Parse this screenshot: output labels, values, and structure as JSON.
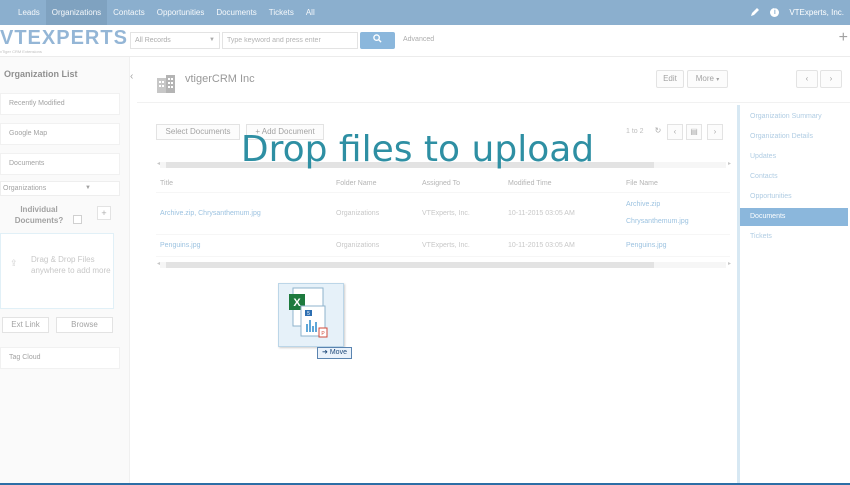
{
  "topnav": {
    "tabs": [
      {
        "label": "Leads"
      },
      {
        "label": "Organizations",
        "active": true
      },
      {
        "label": "Contacts"
      },
      {
        "label": "Opportunities"
      },
      {
        "label": "Documents"
      },
      {
        "label": "Tickets"
      },
      {
        "label": "All"
      }
    ],
    "user": "VTExperts, Inc.",
    "edit_icon": "pencil-icon",
    "help_icon": "info-icon"
  },
  "searchbar": {
    "logo": "VTEXPERTS",
    "logo_sub": "vTiger CRM Extensions",
    "records_select": "All Records",
    "search_placeholder": "Type keyword and press enter",
    "search_button_icon": "search-icon",
    "advanced": "Advanced",
    "add_icon": "plus-icon"
  },
  "sidebar": {
    "title": "Organization List",
    "items": [
      {
        "label": "Recently Modified"
      },
      {
        "label": "Google Map"
      },
      {
        "label": "Documents"
      }
    ],
    "dropdown": "Organizations",
    "individual_documents": "Individual Documents?",
    "add_button": "+",
    "dropzone_text": "Drag & Drop Files anywhere to add more",
    "ext_link": "Ext Link",
    "browse": "Browse",
    "tag_cloud": "Tag Cloud"
  },
  "header": {
    "org_name": "vtigerCRM Inc",
    "edit": "Edit",
    "more": "More"
  },
  "documents": {
    "select_documents": "Select Documents",
    "add_document": "+ Add Document",
    "pager": "1 to 2",
    "columns": [
      "Title",
      "Folder Name",
      "Assigned To",
      "Modified Time",
      "File Name"
    ],
    "rows": [
      {
        "title": "Archive.zip, Chrysanthemum.jpg",
        "folder": "Organizations",
        "assigned": "VTExperts, Inc.",
        "modified": "10-11-2015 03:05 AM",
        "files": [
          "Archive.zip",
          "Chrysanthemum.jpg"
        ]
      },
      {
        "title": "Penguins.jpg",
        "folder": "Organizations",
        "assigned": "VTExperts, Inc.",
        "modified": "10-11-2015 03:05 AM",
        "files": [
          "Penguins.jpg"
        ]
      }
    ]
  },
  "overlay": {
    "drop_text": "Drop files to upload",
    "move_label": "Move"
  },
  "rightpanel": {
    "items": [
      {
        "label": "Organization Summary"
      },
      {
        "label": "Organization Details"
      },
      {
        "label": "Updates"
      },
      {
        "label": "Contacts"
      },
      {
        "label": "Opportunities"
      },
      {
        "label": "Documents",
        "active": true
      },
      {
        "label": "Tickets"
      }
    ]
  }
}
